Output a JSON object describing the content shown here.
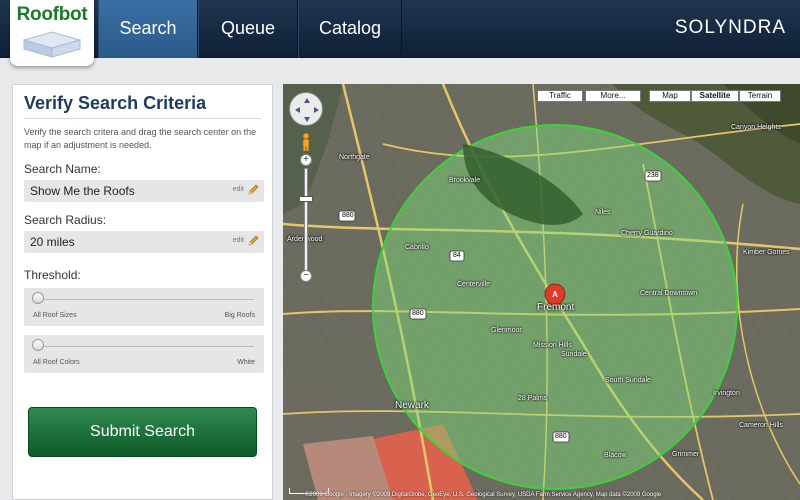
{
  "header": {
    "logo": "Roofbot",
    "tabs": [
      {
        "label": "Search",
        "active": true
      },
      {
        "label": "Queue",
        "active": false
      },
      {
        "label": "Catalog",
        "active": false
      }
    ],
    "brand": "SOLYNDRA",
    "colors": {
      "bar": "#13263d",
      "active_tab": "#3365a0",
      "logo_green": "#1d7a2c"
    }
  },
  "panel": {
    "title": "Verify Search Criteria",
    "description": "Verify the search critera and drag the search center on the map if an adjustment is needed.",
    "search_name": {
      "label": "Search Name:",
      "value": "Show Me the Roofs",
      "edit": "edit"
    },
    "search_radius": {
      "label": "Search Radius:",
      "value": "20 miles",
      "edit": "edit"
    },
    "threshold": {
      "label": "Threshold:",
      "sliders": [
        {
          "min_label": "All Roof Sizes",
          "max_label": "Big Roofs",
          "value": 0
        },
        {
          "min_label": "All Roof Colors",
          "max_label": "White",
          "value": 0
        }
      ]
    },
    "submit_label": "Submit Search",
    "colors": {
      "submit": "#1d6f3a",
      "title": "#1e3a5c"
    }
  },
  "map": {
    "type_buttons": [
      {
        "label": "Traffic",
        "selected": false
      },
      {
        "label": "More...",
        "selected": false
      },
      {
        "label": "Map",
        "selected": false
      },
      {
        "label": "Satellite",
        "selected": true
      },
      {
        "label": "Terrain",
        "selected": false
      }
    ],
    "marker": {
      "letter": "A",
      "label": "Fremont"
    },
    "places": [
      "Brookvale",
      "Niles",
      "Cherry Guardino",
      "Cabrillo",
      "Centerville",
      "Glenmoor",
      "Mission Hills",
      "Sundale",
      "Central Downtown",
      "South Sundale",
      "28 Palms",
      "Blacow",
      "Grimmer",
      "Irvington",
      "Newark",
      "Northgate",
      "Canyon Heights",
      "Cameron Hills",
      "Kimber Gomes",
      "Ardenwood"
    ],
    "highways": [
      "880",
      "84",
      "238",
      "880",
      "880"
    ],
    "attribution": "©2009 Google - Imagery ©2009 DigitalGlobe, GeoEye, U.S. Geological Survey, USDA Farm Service Agency, Map data ©2009 Google",
    "colors": {
      "circle_stroke": "#3cd23c",
      "circle_fill": "#7fe07a"
    }
  }
}
